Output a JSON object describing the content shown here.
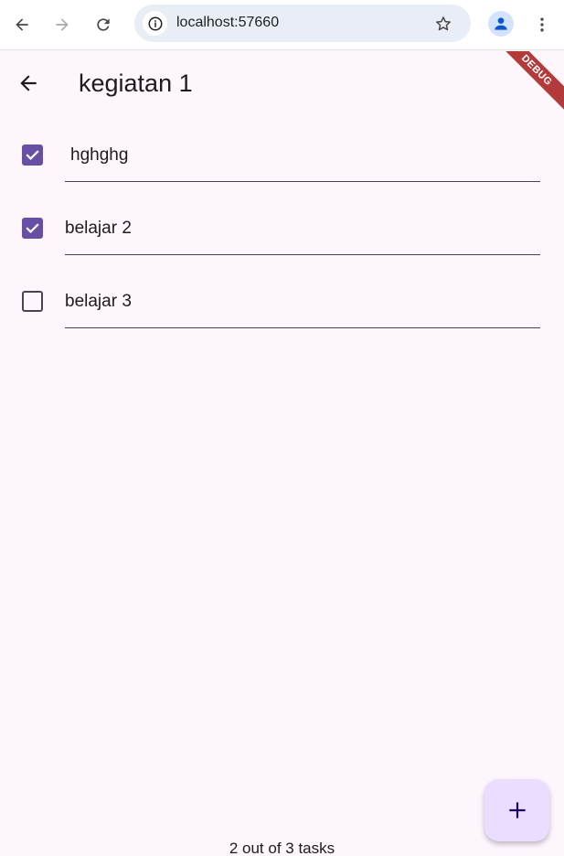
{
  "browser": {
    "url": "localhost:57660",
    "back_icon": "arrow-back-icon",
    "forward_icon": "arrow-forward-icon",
    "reload_icon": "reload-icon"
  },
  "app": {
    "title": "kegiatan 1",
    "debug_label": "DEBUG",
    "accent_color": "#6750a4",
    "background_color": "#fdf6fd",
    "tasks": [
      {
        "label": "hghghg",
        "checked": true
      },
      {
        "label": "belajar 2",
        "checked": true
      },
      {
        "label": "belajar 3",
        "checked": false
      }
    ],
    "status": "2 out of 3 tasks",
    "fab_icon": "plus-icon"
  }
}
